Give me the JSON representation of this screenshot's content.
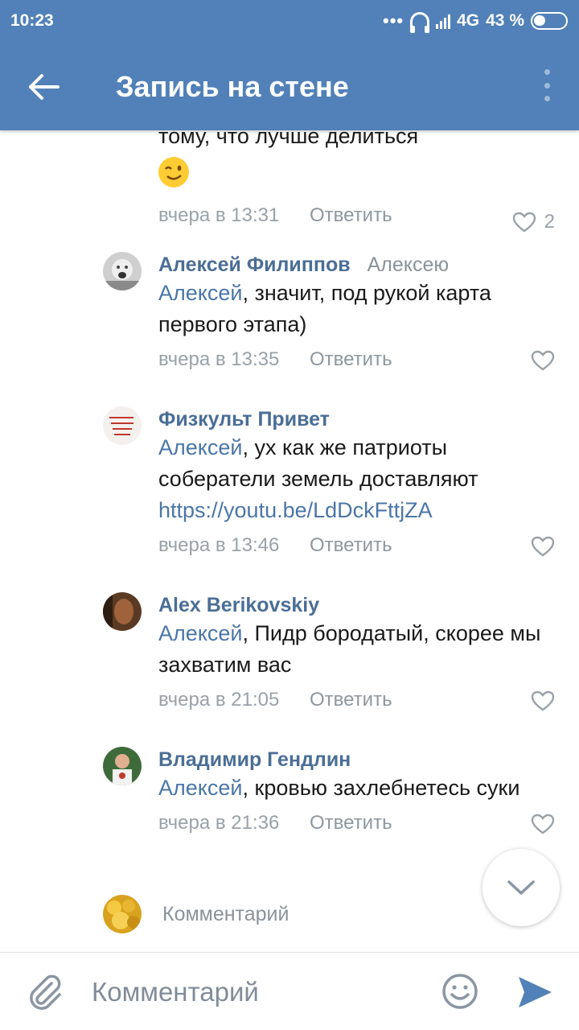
{
  "status_bar": {
    "time": "10:23",
    "network": "4G",
    "battery": "43 %"
  },
  "app_bar": {
    "title": "Запись на стене"
  },
  "comments": [
    {
      "text_tail": "тому, что лучше делиться",
      "time": "вчера в 13:31",
      "reply_label": "Ответить",
      "likes": "2"
    },
    {
      "author": "Алексей Филиппов",
      "reply_to": "Алексею",
      "mention": "Алексей",
      "text": ", значит, под рукой карта первого этапа)",
      "time": "вчера в 13:35",
      "reply_label": "Ответить"
    },
    {
      "author": "Физкульт Привет",
      "mention": "Алексей",
      "text": ", ух как же патриоты собератели земель доставляют",
      "link": "https://youtu.be/LdDckFttjZA",
      "time": "вчера в 13:46",
      "reply_label": "Ответить"
    },
    {
      "author": "Alex Berikovskiy",
      "mention": "Алексей",
      "text": ", Пидр бородатый, скорее мы захватим вас",
      "time": "вчера в 21:05",
      "reply_label": "Ответить"
    },
    {
      "author": "Владимир Гендлин",
      "mention": "Алексей",
      "text": ", кровью захлебнетесь суки",
      "time": "вчера в 21:36",
      "reply_label": "Ответить"
    }
  ],
  "mini_composer": {
    "placeholder": "Комментарий"
  },
  "composer": {
    "placeholder": "Комментарий"
  },
  "icons": {
    "back": "arrow-left-icon",
    "more": "more-vertical-icon",
    "like": "heart-icon",
    "scroll_down": "chevron-down-icon",
    "attach": "paperclip-icon",
    "emoji": "smile-icon",
    "send": "send-icon"
  },
  "colors": {
    "header": "#5181b8",
    "author": "#4a6e96",
    "link": "#4a76a8",
    "meta": "#9aa1a8"
  }
}
